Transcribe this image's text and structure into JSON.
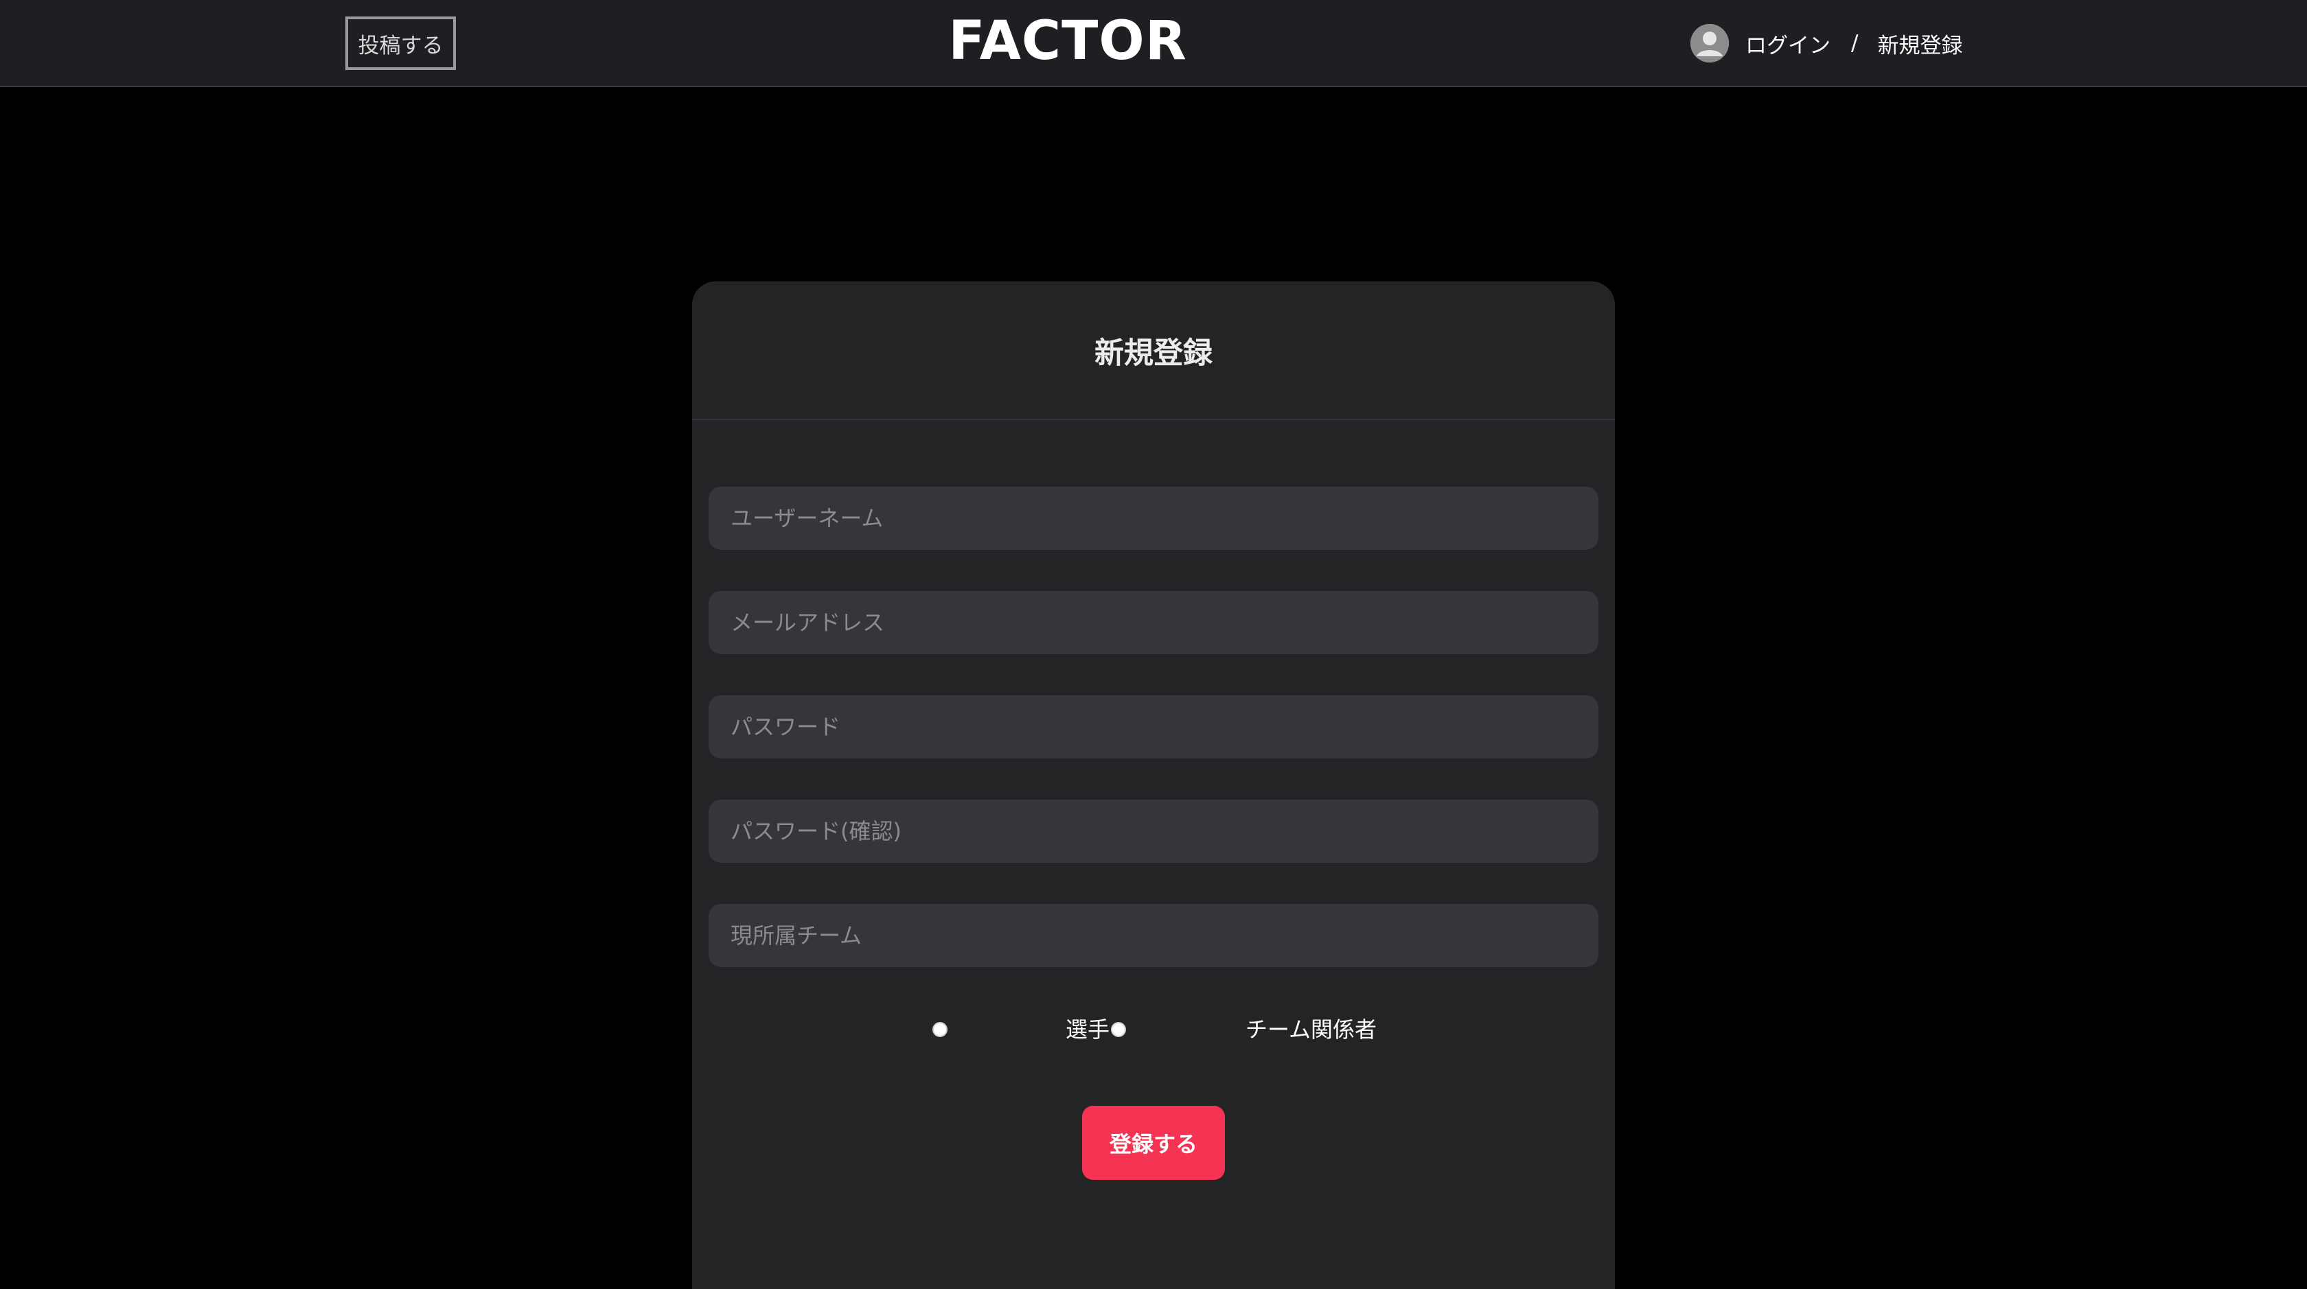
{
  "header": {
    "post_button_label": "投稿する",
    "logo_text": "FACTOR",
    "login_label": "ログイン",
    "separator": "/",
    "signup_label": "新規登録",
    "avatar_icon": "user-avatar-icon"
  },
  "form": {
    "title": "新規登録",
    "fields": {
      "username": {
        "placeholder": "ユーザーネーム",
        "value": ""
      },
      "email": {
        "placeholder": "メールアドレス",
        "value": ""
      },
      "password": {
        "placeholder": "パスワード",
        "value": ""
      },
      "password_confirm": {
        "placeholder": "パスワード(確認)",
        "value": ""
      },
      "team": {
        "placeholder": "現所属チーム",
        "value": ""
      }
    },
    "roles": {
      "player_label": "選手",
      "staff_label": "チーム関係者"
    },
    "submit_label": "登録する"
  },
  "colors": {
    "header_background": "#1e1f23",
    "page_background": "#000000",
    "card_background": "#242426",
    "input_background": "#35363b",
    "accent": "#f53352"
  }
}
